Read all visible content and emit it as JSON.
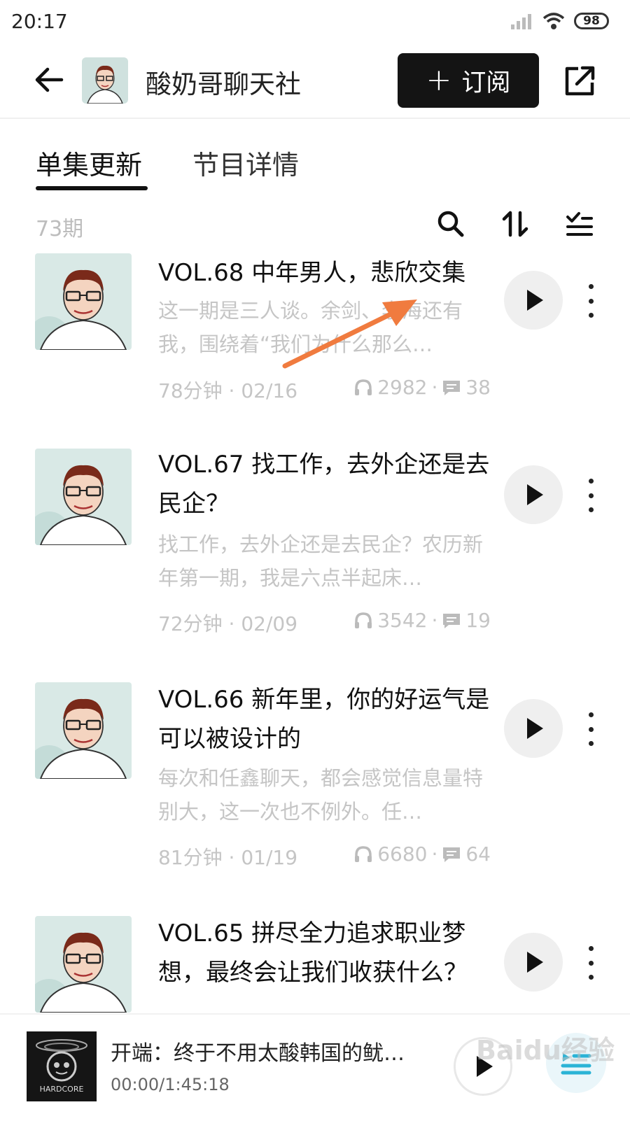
{
  "status": {
    "time": "20:17",
    "battery": "98"
  },
  "header": {
    "title": "酸奶哥聊天社",
    "subscribe_label": "订阅"
  },
  "tabs": [
    {
      "label": "单集更新"
    },
    {
      "label": "节目详情"
    }
  ],
  "toolbar": {
    "count": "73期"
  },
  "episodes": [
    {
      "title": "VOL.68 中年男人，悲欣交集",
      "desc": "这一期是三人谈。余剑、李海还有我，围绕着“我们为什么那么…",
      "duration_date": "78分钟 · 02/16",
      "plays": "2982",
      "comments": "38"
    },
    {
      "title": "VOL.67 找工作，去外企还是去民企？",
      "desc": "找工作，去外企还是去民企？农历新年第一期，我是六点半起床…",
      "duration_date": "72分钟 · 02/09",
      "plays": "3542",
      "comments": "19"
    },
    {
      "title": "VOL.66 新年里，你的好运气是可以被设计的",
      "desc": "每次和任鑫聊天，都会感觉信息量特别大，这一次也不例外。任…",
      "duration_date": "81分钟 · 01/19",
      "plays": "6680",
      "comments": "64"
    },
    {
      "title": "VOL.65 拼尽全力追求职业梦想，最终会让我们收获什么？"
    }
  ],
  "player": {
    "title": "开端：终于不用太酸韩国的鱿…",
    "time": "00:00/1:45:18",
    "cover_text": "HARDCORE"
  },
  "watermark": "Baidu经验",
  "colors": {
    "accent_arrow": "#f07b3f",
    "subscribe_bg": "#141414",
    "muted_text": "#c5c5c5"
  }
}
